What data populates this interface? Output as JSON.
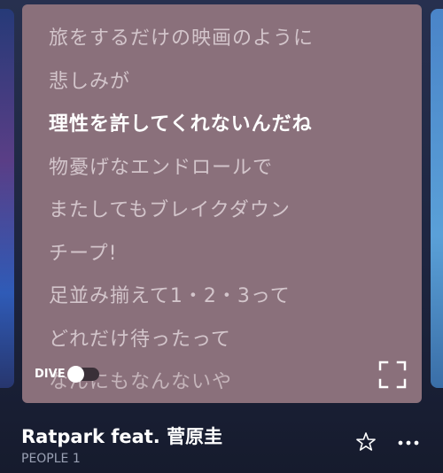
{
  "lyrics": {
    "lines": [
      "旅をするだけの映画のように",
      "悲しみが",
      "理性を許してくれないんだね",
      "物憂げなエンドロールで",
      "またしてもブレイクダウン",
      "チープ!",
      "足並み揃えて1・2・3って",
      "どれだけ待ったって",
      "なんにもなんないや"
    ],
    "active_index": 2
  },
  "dive": {
    "label": "DIVE",
    "enabled": false
  },
  "song": {
    "title": "Ratpark feat. 菅原圭",
    "artist": "PEOPLE 1"
  },
  "icons": {
    "fullscreen": "fullscreen-icon",
    "star": "star-icon",
    "more": "more-icon"
  },
  "colors": {
    "card_background": "#8a707b",
    "active_lyric": "#ffffff",
    "inactive_lyric": "#d3c5cb",
    "page_background": "#1c2238"
  }
}
